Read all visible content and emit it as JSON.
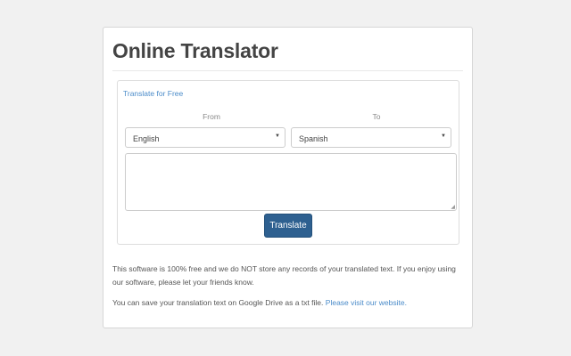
{
  "title": "Online Translator",
  "panel": {
    "title": "Translate for Free",
    "from_label": "From",
    "to_label": "To",
    "from_value": "English",
    "to_value": "Spanish",
    "text_value": "",
    "button": "Translate"
  },
  "footer": {
    "p1": "This software is 100% free and we do NOT store any records of your translated text. If you enjoy using our software, please let your friends know.",
    "p2": "You can save your translation text on Google Drive as a txt file.",
    "link": "Please visit our website."
  }
}
